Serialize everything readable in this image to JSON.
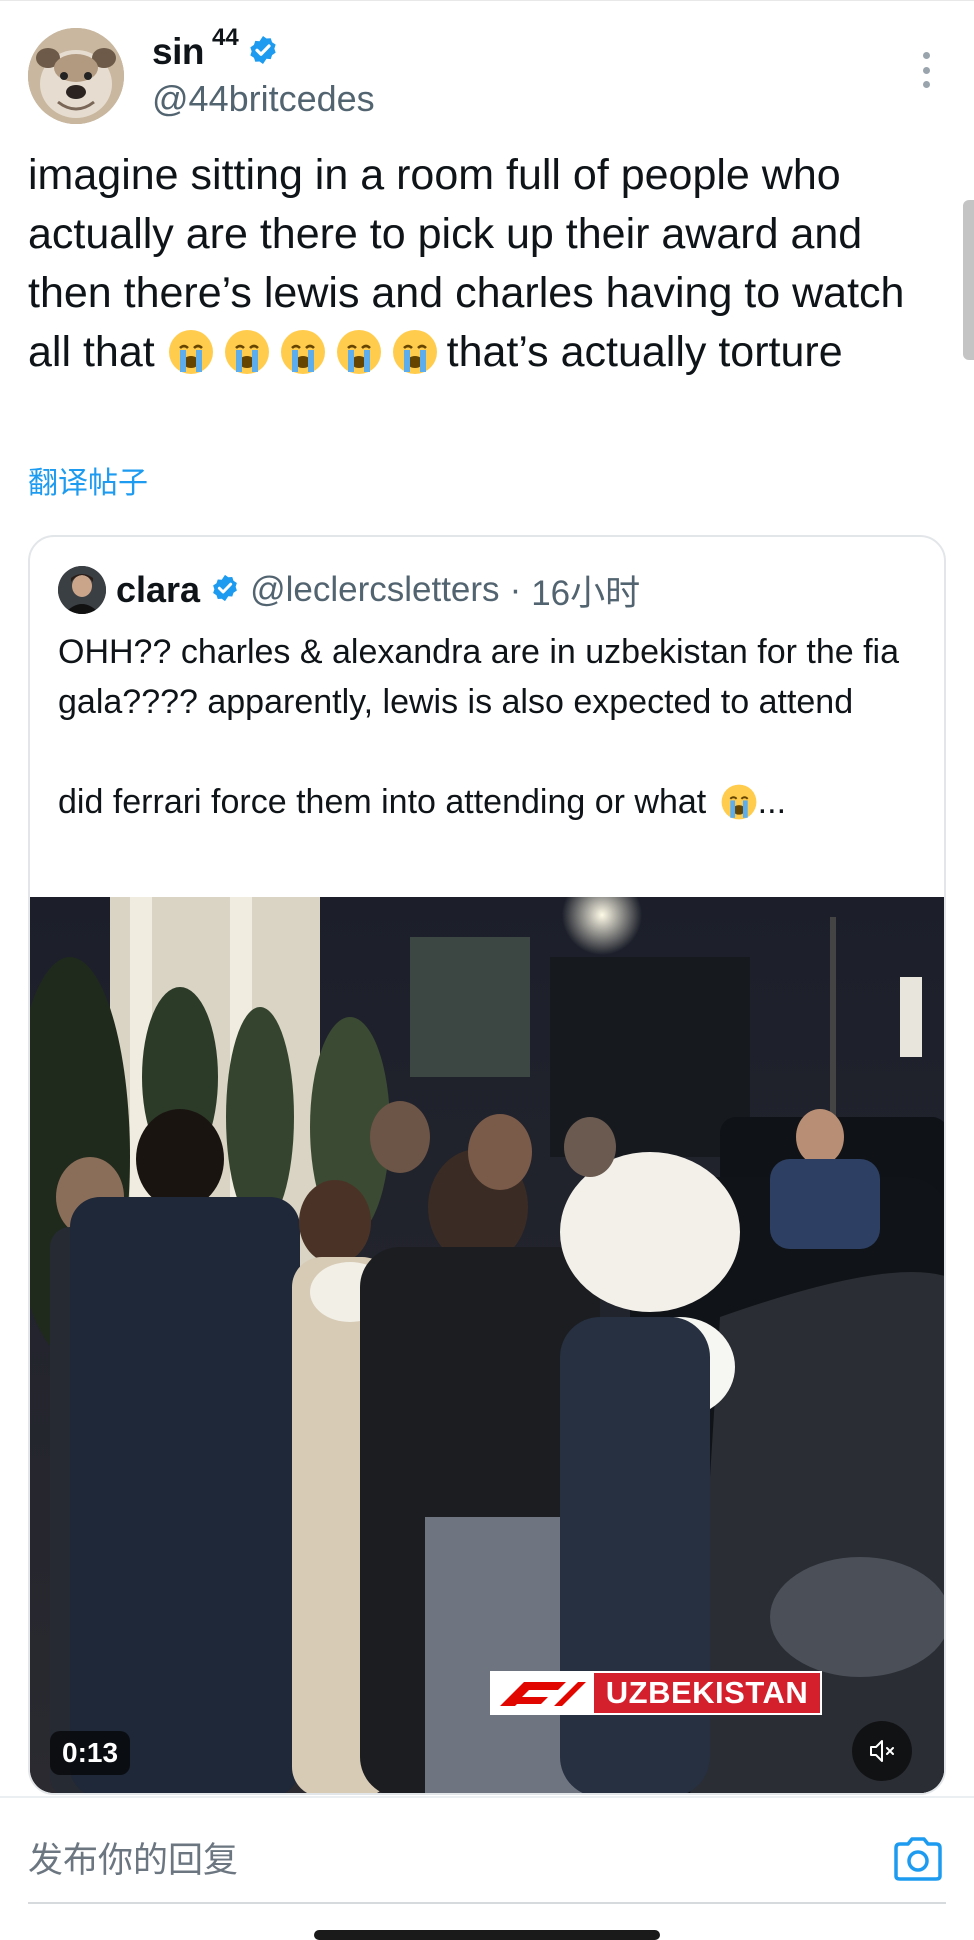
{
  "post": {
    "author_name": "sin",
    "author_suffix": "44",
    "verified": true,
    "handle": "@44britcedes",
    "text_before_emojis": "imagine sitting in a room full of people who actually are there to pick up their award and then there’s lewis and charles having to watch all that ",
    "emoji_count": 5,
    "text_after_emojis": "that’s actually torture",
    "translate_label": "翻译帖子"
  },
  "quoted": {
    "author_name": "clara",
    "verified": true,
    "handle": "@leclercsletters",
    "separator": "·",
    "time": "16小时",
    "text": "OHH?? charles & alexandra are in uzbekistan for the fia gala???? apparently, lewis is also expected to attend\n\ndid ferrari force them into attending or what ",
    "text_ellipsis": "...",
    "video": {
      "duration": "0:13",
      "banner_text": "UZBEKISTAN",
      "muted": true
    }
  },
  "reply_bar": {
    "placeholder": "发布你的回复"
  },
  "colors": {
    "accent": "#1d9bf0",
    "text": "#0f1419",
    "secondary": "#536471",
    "f1_red": "#d4202c"
  },
  "icons": [
    "verified-badge-icon",
    "more-vertical-icon",
    "crying-emoji-icon",
    "mute-icon",
    "camera-icon",
    "f1-logo-icon"
  ]
}
